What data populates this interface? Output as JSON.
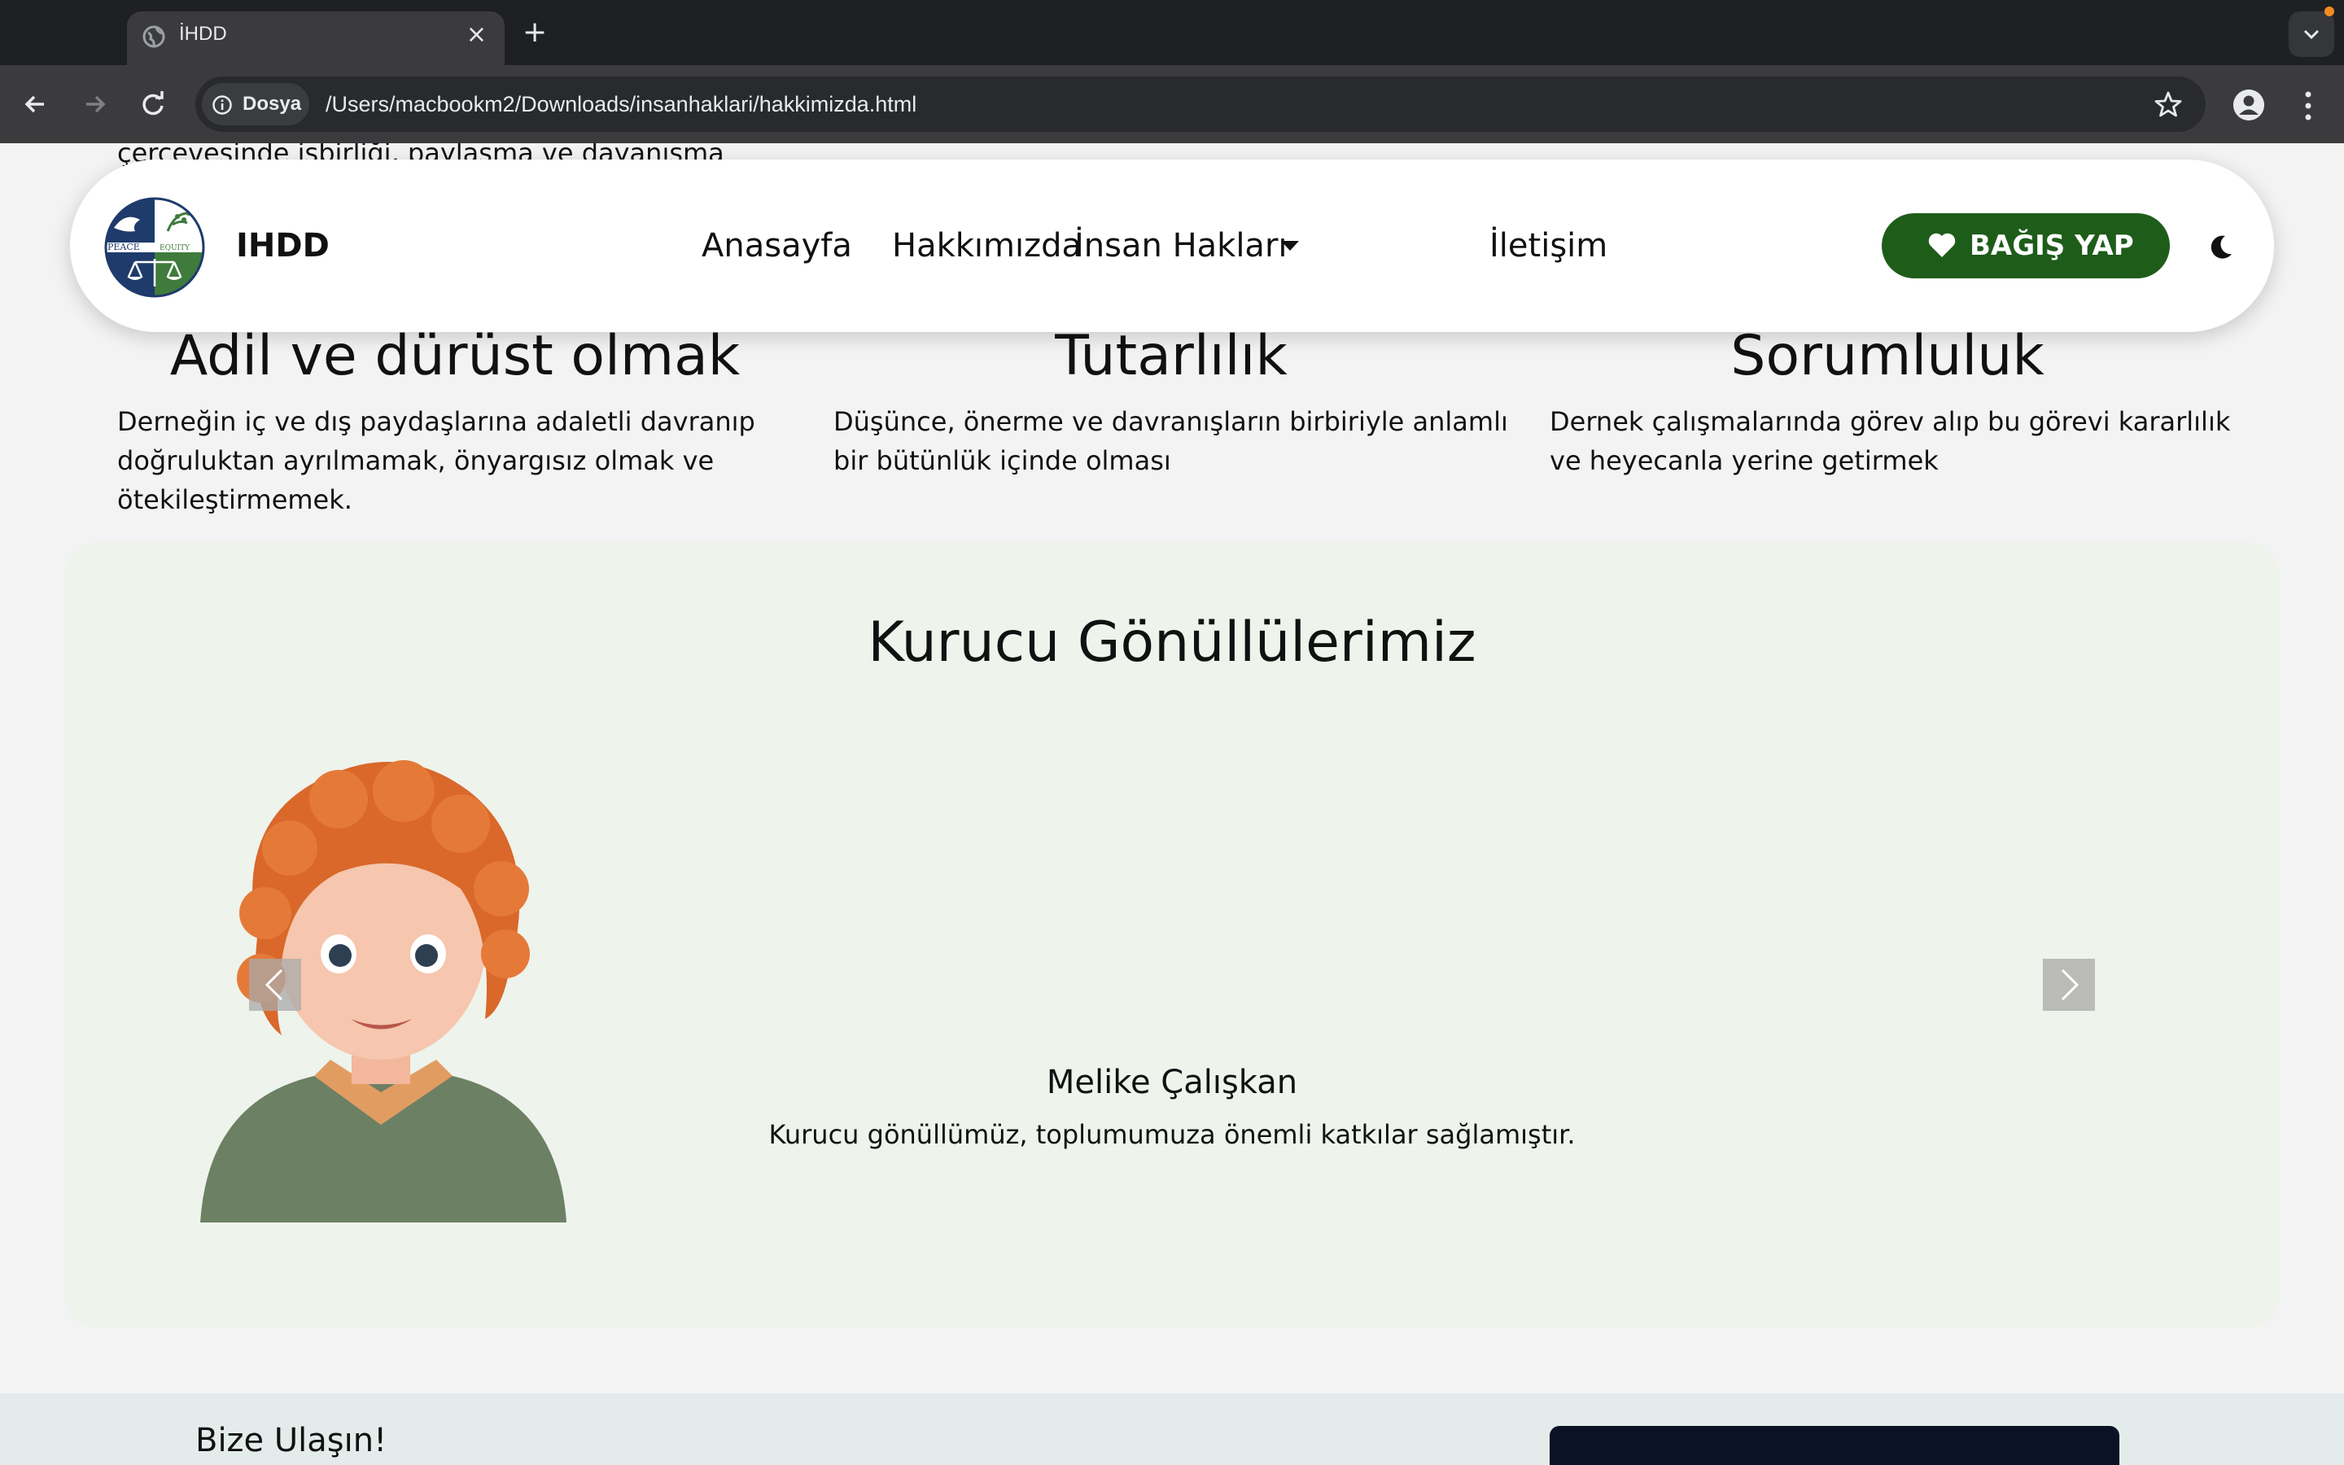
{
  "browser": {
    "tab_title": "İHDD",
    "tab_close": "×",
    "new_tab": "+",
    "chip_label": "Dosya",
    "url": "/Users/macbookm2/Downloads/insanhaklari/hakkimizda.html",
    "icons": [
      "globe-icon",
      "close-icon",
      "plus-icon",
      "chevron-down-icon",
      "back-icon",
      "forward-icon",
      "reload-icon",
      "info-icon",
      "star-icon",
      "profile-icon",
      "more-icon"
    ]
  },
  "page": {
    "partial_text": "çerçevesinde işbirliği, paylaşma ve dayanışma",
    "navbar": {
      "brand": "IHDD",
      "logo_text_left": "PEACE",
      "logo_text_right": "EQUITY",
      "menu": {
        "home": "Anasayfa",
        "about": "Hakkımızda",
        "human_rights": "İnsan Hakları",
        "contact": "İletişim"
      },
      "donate_label": "BAĞIŞ YAP"
    },
    "values": [
      {
        "title": "Adil ve dürüst olmak",
        "text": "Derneğin iç ve dış paydaşlarına adaletli davranıp doğruluktan ayrılmamak, önyargısız olmak ve ötekileştirmemek."
      },
      {
        "title": "Tutarlılık",
        "text": "Düşünce, önerme ve davranışların birbiriyle anlamlı bir bütünlük içinde olması"
      },
      {
        "title": "Sorumluluk",
        "text": "Dernek çalışmalarında görev alıp bu görevi kararlılık ve heyecanla yerine getirmek"
      }
    ],
    "founders": {
      "title": "Kurucu Gönüllülerimiz",
      "name": "Melike Çalışkan",
      "description": "Kurucu gönüllümüz, toplumumuza önemli katkılar sağlamıştır."
    },
    "contact": {
      "title": "Bize Ulaşın!"
    }
  },
  "colors": {
    "brand_green": "#1e5c1a",
    "founders_bg": "#eef3ec",
    "chrome_dark": "#1f2022",
    "chrome_toolbar": "#3b3b3d"
  }
}
